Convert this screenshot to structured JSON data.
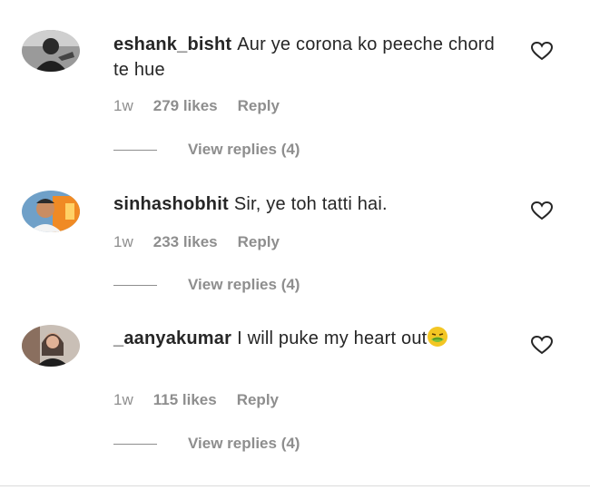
{
  "comments": [
    {
      "username": "eshank_bisht",
      "text": "Aur ye corona ko peeche chord te hue",
      "age": "1w",
      "likes": "279 likes",
      "reply": "Reply",
      "view_replies": "View replies (4)",
      "avatar_color": "#3a3a3a"
    },
    {
      "username": "sinhashobhit",
      "text": "Sir, ye toh tatti hai.",
      "age": "1w",
      "likes": "233 likes",
      "reply": "Reply",
      "view_replies": "View replies (4)",
      "avatar_color": "#e2a23a"
    },
    {
      "username": "_aanyakumar",
      "text": "I will puke my heart out",
      "emoji": "nauseated-face-emoji",
      "age": "1w",
      "likes": "115 likes",
      "reply": "Reply",
      "view_replies": "View replies (4)",
      "avatar_color": "#5a4a48"
    }
  ],
  "colors": {
    "text": "#262626",
    "secondary": "#8e8e8e",
    "divider": "#dbdbdb"
  },
  "icons": {
    "like": "heart-outline-icon"
  }
}
